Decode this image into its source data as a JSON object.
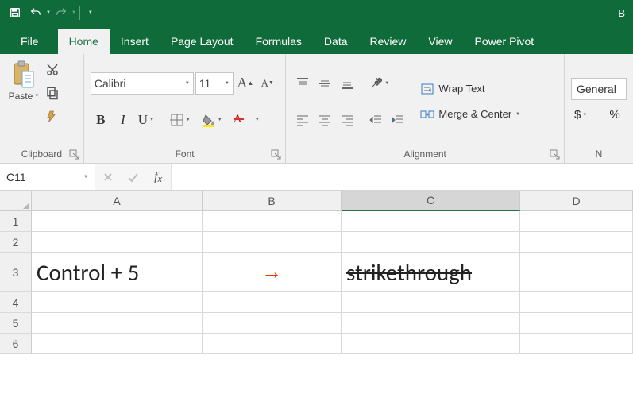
{
  "title_right": "B",
  "tabs": {
    "file": "File",
    "home": "Home",
    "insert": "Insert",
    "pagelayout": "Page Layout",
    "formulas": "Formulas",
    "data": "Data",
    "review": "Review",
    "view": "View",
    "powerpivot": "Power Pivot"
  },
  "ribbon": {
    "clipboard": {
      "paste": "Paste",
      "label": "Clipboard"
    },
    "font": {
      "name": "Calibri",
      "size": "11",
      "label": "Font"
    },
    "alignment": {
      "wrap": "Wrap Text",
      "merge": "Merge & Center",
      "label": "Alignment"
    },
    "number": {
      "format": "General",
      "currency": "$",
      "percent": "%",
      "label": "N"
    }
  },
  "formula_bar": {
    "name_box": "C11",
    "value": ""
  },
  "grid": {
    "cols": [
      "A",
      "B",
      "C",
      "D"
    ],
    "rows": [
      "1",
      "2",
      "3",
      "4",
      "5",
      "6"
    ],
    "A3": "Control + 5",
    "B3": "→",
    "C3": "strikethrough",
    "selected": "C11"
  }
}
